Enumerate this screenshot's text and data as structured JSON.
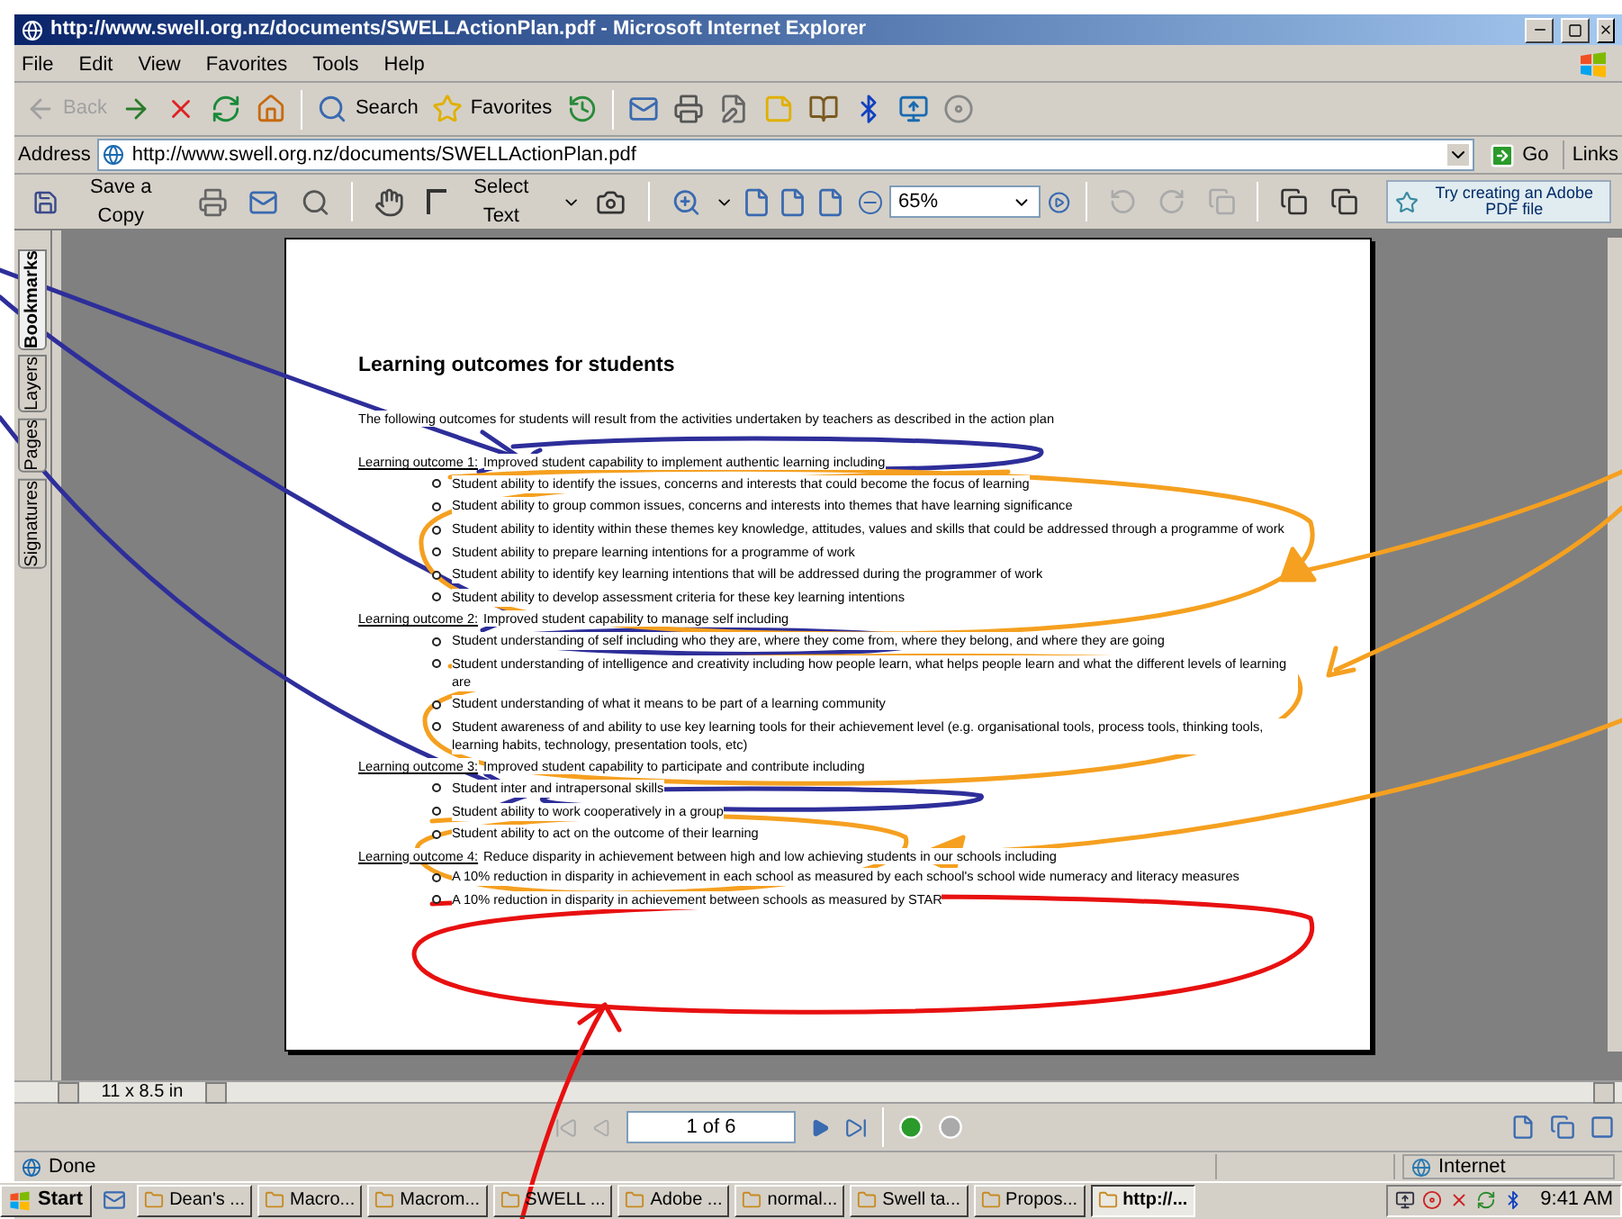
{
  "window": {
    "title": "http://www.swell.org.nz/documents/SWELLActionPlan.pdf - Microsoft Internet Explorer"
  },
  "menu": [
    "File",
    "Edit",
    "View",
    "Favorites",
    "Tools",
    "Help"
  ],
  "toolbar": [
    {
      "kind": "back",
      "label": "Back",
      "disabled": true
    },
    {
      "kind": "forward",
      "disabled": false
    },
    {
      "kind": "stop"
    },
    {
      "kind": "refresh"
    },
    {
      "kind": "home"
    },
    {
      "kind": "search",
      "label": "Search"
    },
    {
      "kind": "favorites",
      "label": "Favorites"
    },
    {
      "kind": "history"
    },
    {
      "kind": "mail"
    },
    {
      "kind": "print"
    },
    {
      "kind": "edit"
    },
    {
      "kind": "note"
    },
    {
      "kind": "research"
    },
    {
      "kind": "bluetooth"
    },
    {
      "kind": "messenger"
    },
    {
      "kind": "disc"
    }
  ],
  "address": {
    "label": "Address",
    "value": "http://www.swell.org.nz/documents/SWELLActionPlan.pdf",
    "go": "Go",
    "links": "Links"
  },
  "acrobat_toolbar": {
    "save": "Save a Copy",
    "select": "Select Text",
    "zoom": "65%",
    "promo": "Try creating an Adobe PDF file"
  },
  "nav_tabs": [
    {
      "label": "Bookmarks",
      "selected": true
    },
    {
      "label": "Layers",
      "selected": false
    },
    {
      "label": "Pages",
      "selected": false
    },
    {
      "label": "Signatures",
      "selected": false
    }
  ],
  "document": {
    "heading": "Learning outcomes for students",
    "intro": "The following outcomes for students will result from the activities undertaken by teachers as described in the action plan",
    "outcomes": [
      {
        "label": "Learning outcome 1:",
        "text": "Improved student capability to implement authentic learning including",
        "items": [
          "Student ability to identify the issues, concerns and interests that could become the focus of learning",
          "Student ability to group common issues, concerns and interests into themes that have learning significance",
          "Student ability to identity within these themes key knowledge, attitudes, values and skills that could be addressed through a programme of work",
          "Student ability to prepare learning intentions for a programme of work",
          "Student ability to identify key learning intentions that will be addressed during the programmer of work",
          "Student ability to develop assessment criteria for these key learning intentions"
        ]
      },
      {
        "label": "Learning outcome 2:",
        "text": "Improved student capability to manage self including",
        "items": [
          "Student understanding of self including who they are, where they come from, where they belong, and where they are going",
          "Student understanding of intelligence and creativity including how people learn, what helps people learn and what the different levels of learning are",
          "Student understanding of what it means to be part of a learning community",
          "Student awareness of and ability to use key learning tools for their achievement level (e.g. organisational tools, process tools, thinking tools, learning habits, technology, presentation tools, etc)"
        ]
      },
      {
        "label": "Learning outcome 3:",
        "text": "Improved student capability to participate and contribute including",
        "items": [
          "Student inter and intrapersonal skills",
          "Student ability to work cooperatively in a group",
          "Student ability to act on the outcome of their learning"
        ]
      },
      {
        "label": "Learning outcome 4:",
        "text": "Reduce disparity in achievement between high and low achieving students in our schools including",
        "items": [
          "A 10% reduction in disparity in achievement in each school as measured by each school's school wide numeracy and literacy measures",
          "A 10% reduction in disparity in achievement between schools as measured by STAR"
        ]
      }
    ]
  },
  "page_size": "11 x 8.5 in",
  "page_nav": {
    "page": "1 of 6"
  },
  "status_bar": {
    "text": "Done",
    "zone": "Internet"
  },
  "taskbar": {
    "start": "Start",
    "tasks": [
      {
        "label": "Dean's ...",
        "selected": false
      },
      {
        "label": "Macro...",
        "selected": false
      },
      {
        "label": "Macrom...",
        "selected": false
      },
      {
        "label": "SWELL ...",
        "selected": false
      },
      {
        "label": "Adobe ...",
        "selected": false
      },
      {
        "label": "normal...",
        "selected": false
      },
      {
        "label": "Swell ta...",
        "selected": false
      },
      {
        "label": "Propos...",
        "selected": false
      },
      {
        "label": "http://...",
        "selected": true
      }
    ],
    "clock": "9:41 AM"
  }
}
